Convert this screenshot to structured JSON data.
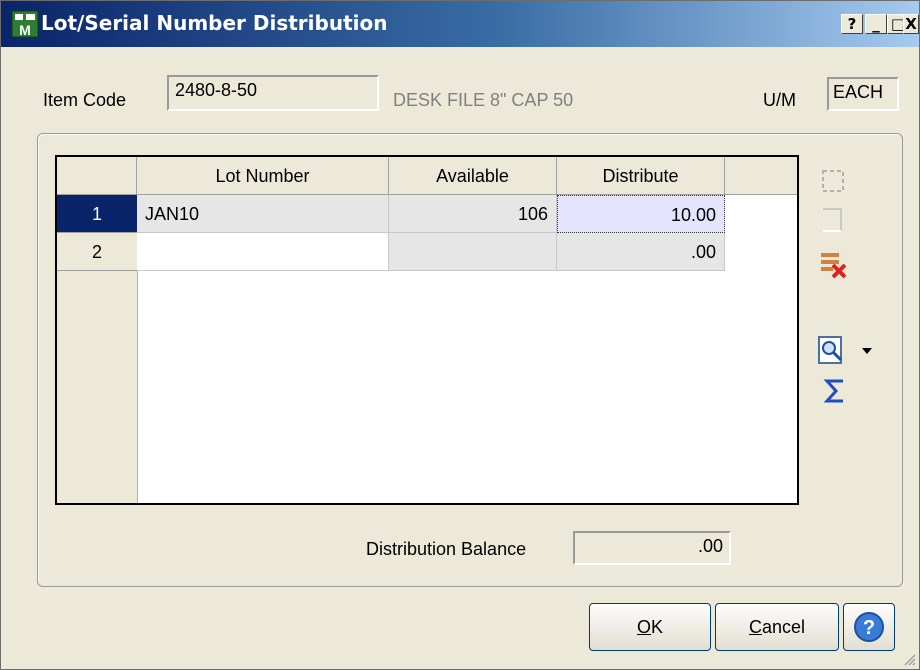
{
  "window": {
    "title": "Lot/Serial Number Distribution"
  },
  "titlebar_buttons": {
    "help": "?",
    "minimize": "_",
    "maximize": "□",
    "close": "X"
  },
  "item": {
    "code_label": "Item Code",
    "code_value": "2480-8-50",
    "description": "DESK FILE 8\" CAP 50",
    "um_label": "U/M",
    "um_value": "EACH"
  },
  "grid": {
    "columns": [
      "Lot Number",
      "Available",
      "Distribute"
    ],
    "rows": [
      {
        "num": "1",
        "lot": "JAN10",
        "available": "106",
        "distribute": "10.00"
      },
      {
        "num": "2",
        "lot": "",
        "available": "",
        "distribute": ".00"
      }
    ]
  },
  "balance": {
    "label": "Distribution Balance",
    "value": ".00"
  },
  "buttons": {
    "ok_mnemonic": "O",
    "ok_rest": "K",
    "cancel_mnemonic": "C",
    "cancel_rest": "ancel",
    "help": "?"
  },
  "icons": [
    "insert-row-icon",
    "blank-row-icon",
    "delete-row-icon",
    "lookup-icon",
    "dropdown-arrow-icon",
    "sum-icon"
  ]
}
